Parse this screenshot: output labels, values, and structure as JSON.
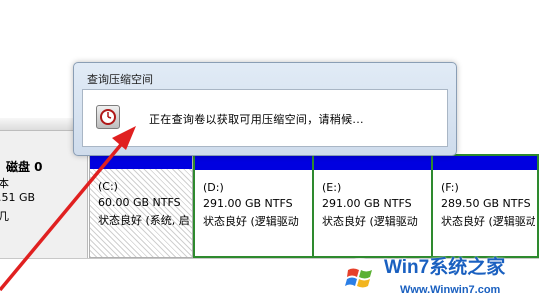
{
  "dialog": {
    "title": "查询压缩空间",
    "message": "正在查询卷以获取可用压缩空间，请稍候..."
  },
  "disk": {
    "name": "磁盘 0",
    "type": "本",
    "size": ".51 GB",
    "status": "几"
  },
  "volumes": [
    {
      "label": "(C:)",
      "size": "60.00 GB NTFS",
      "status": "状态良好 (系统, 启"
    },
    {
      "label": "(D:)",
      "size": "291.00 GB NTFS",
      "status": "状态良好 (逻辑驱动"
    },
    {
      "label": "(E:)",
      "size": "291.00 GB NTFS",
      "status": "状态良好 (逻辑驱动"
    },
    {
      "label": "(F:)",
      "size": "289.50 GB NTFS",
      "status": "状态良好 (逻辑驱动"
    }
  ],
  "watermark": {
    "brand": "Win7系统之家",
    "url": "Www.Winwin7.com"
  },
  "colors": {
    "partition_stripe": "#0000e0",
    "selection_border": "#2e8a2e",
    "arrow": "#e02020",
    "watermark": "#1a60c0"
  }
}
